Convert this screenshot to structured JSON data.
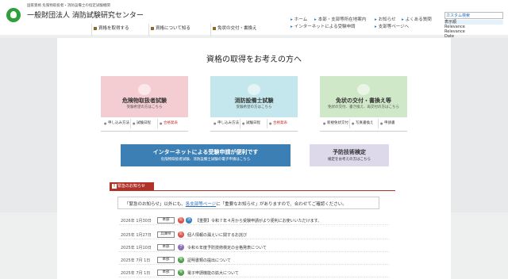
{
  "header": {
    "org_sub": "国家資格 危険物取扱者・消防設備士の指定試験機関",
    "org_name": "一般財団法人 消防試験研究センター"
  },
  "util_nav": [
    {
      "label": "ホーム"
    },
    {
      "label": "本部・支部等所在地案内"
    },
    {
      "label": "インターネットによる受験申請"
    },
    {
      "label": "お知らせ"
    },
    {
      "label": "よくある質問"
    },
    {
      "label": "支部等ページへ"
    }
  ],
  "search": {
    "label": "カスタム検索",
    "options": [
      "表示順",
      "Relevance",
      "Relevance",
      "Date"
    ]
  },
  "main_nav": [
    {
      "label": "資格を取得する"
    },
    {
      "label": "資格について知る"
    },
    {
      "label": "免状の交付・書換え"
    }
  ],
  "page_title": "資格の取得をお考えの方へ",
  "cards": [
    {
      "title": "危険物取扱者試験",
      "sub": "受験希望の方はこちら",
      "color": "#f4cdd2",
      "links": [
        {
          "label": "申し込み方法",
          "red": false
        },
        {
          "label": "試験日程",
          "red": false
        },
        {
          "label": "合格発表",
          "red": true
        }
      ]
    },
    {
      "title": "消防設備士試験",
      "sub": "受験希望の方はこちら",
      "color": "#c3e7ec",
      "links": [
        {
          "label": "申し込み方法",
          "red": false
        },
        {
          "label": "試験日程",
          "red": false
        },
        {
          "label": "合格発表",
          "red": true
        }
      ]
    },
    {
      "title": "免状の交付・書換え等",
      "sub": "免状の交付、書き換え、再交付の方はこちら",
      "color": "#cfe8c8",
      "links": [
        {
          "label": "新規免状交付",
          "red": false
        },
        {
          "label": "写真書換え",
          "red": false
        },
        {
          "label": "申請書",
          "red": false
        }
      ]
    }
  ],
  "banners": {
    "internet": {
      "title": "インターネットによる受験申請が便利です",
      "sub": "危険物取扱者試験、消防設備士試験の電子申請はこちら",
      "color": "#3b7fb5"
    },
    "yobou": {
      "title": "予防技術検定",
      "sub": "検定をお考えの方はこちら",
      "color": "#ddd9ea"
    }
  },
  "notice": {
    "tab_label": "緊急のお知らせ",
    "text_before": "「緊急のお知らせ」以外にも、",
    "link": "各支部等ページ",
    "text_after": "に「重要なお知らせ」がありますので、合わせてご確認ください。"
  },
  "news": [
    {
      "date": "2026年 1月30日",
      "cat": "本部",
      "tag": "危",
      "tag_color": "#d9524a",
      "tag2": "消",
      "tag2_color": "#3a7fc1",
      "title": "【重要】令和７年４月から受験申請がより便利にお使いいただけます。"
    },
    {
      "date": "2025年 1月27日",
      "cat": "兵庫県",
      "tag": "危",
      "tag_color": "#d9524a",
      "tag2": "",
      "tag2_color": "",
      "title": "個人情報の漏えいに関するお詫び"
    },
    {
      "date": "2025年 1月10日",
      "cat": "本部",
      "tag": "予",
      "tag_color": "#8a6fb5",
      "tag2": "",
      "tag2_color": "",
      "title": "令和６年度予防技術検定の合格発表について"
    },
    {
      "date": "2025年 7月 1日",
      "cat": "本部",
      "tag": "免",
      "tag_color": "#4e9e4a",
      "tag2": "",
      "tag2_color": "",
      "title": "証明書類の提出について"
    },
    {
      "date": "2025年 7月 1日",
      "cat": "本部",
      "tag": "免",
      "tag_color": "#4e9e4a",
      "tag2": "",
      "tag2_color": "",
      "title": "電子申請機能の拡大について"
    }
  ]
}
